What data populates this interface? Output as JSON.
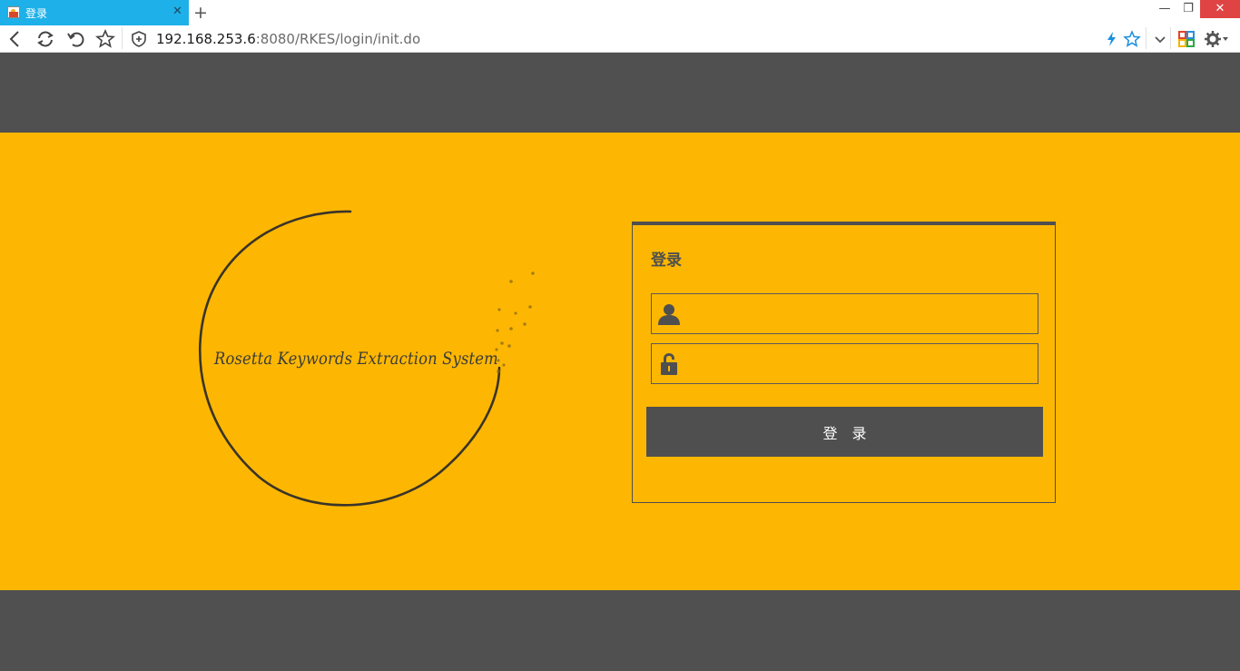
{
  "browser": {
    "tab_title": "登录",
    "new_tab_label": "+",
    "close_tab_label": "✕",
    "url_host": "192.168.253.6",
    "url_rest": ":8080/RKES/login/init.do",
    "window_min_label": "—",
    "window_max_label": "❐",
    "window_close_label": "✕",
    "icons": [
      "back-icon",
      "reload-icon",
      "undo-icon",
      "favorite-icon",
      "shield-icon",
      "lightning-icon",
      "star-icon",
      "dropdown-icon",
      "apps-icon",
      "settings-icon"
    ]
  },
  "page": {
    "logo_text": "Rosetta Keywords Extraction System",
    "login": {
      "title": "登录",
      "username_value": "",
      "password_value": "",
      "submit_label": "登　录"
    },
    "colors": {
      "accent": "#fdb702",
      "dark": "#505050"
    }
  }
}
